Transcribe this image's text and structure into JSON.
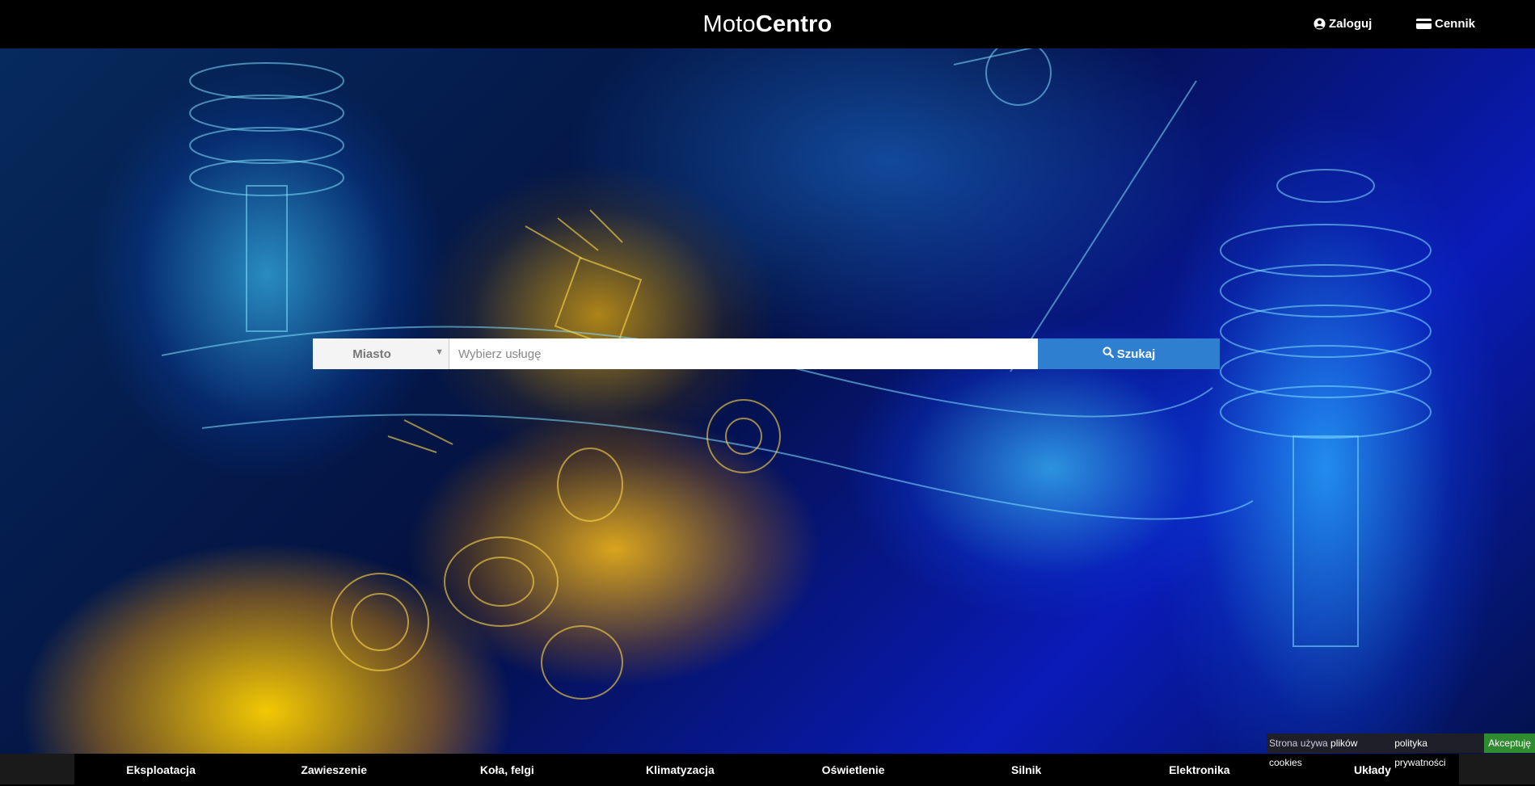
{
  "header": {
    "logo_light": "Moto",
    "logo_bold": "Centro",
    "login_label": "Zaloguj",
    "pricing_label": "Cennik",
    "login_icon": "user-circle-icon",
    "pricing_icon": "credit-card-icon"
  },
  "search": {
    "city_label": "Miasto",
    "service_placeholder": "Wybierz usługę",
    "button_label": "Szukaj",
    "button_icon": "search-icon",
    "button_color": "#2f7fd1"
  },
  "cookies": {
    "message_start": "Strona używa ",
    "message_link": "plików cookies",
    "policy_label": "polityka prywatności",
    "accept_label": "Akceptuję",
    "accept_color": "#2f8b2f"
  },
  "categories": [
    "Eksploatacja",
    "Zawieszenie",
    "Koła, felgi",
    "Klimatyzacja",
    "Oświetlenie",
    "Silnik",
    "Elektronika",
    "Układy"
  ]
}
